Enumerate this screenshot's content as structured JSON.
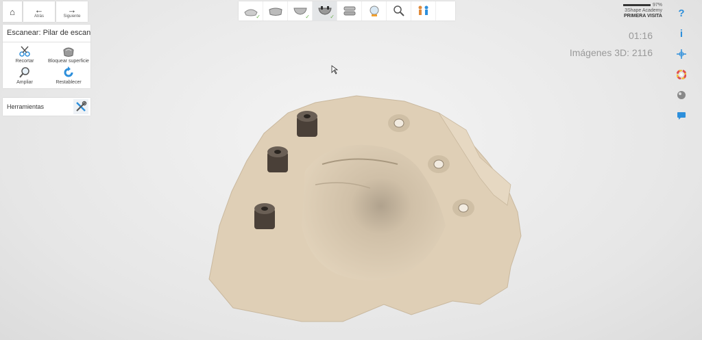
{
  "nav": {
    "back_label": "Atrás",
    "next_label": "Siguiente"
  },
  "panel": {
    "title": "Escanear: Pilar de escanea",
    "tools": [
      {
        "label": "Recortar",
        "icon": "scissors-icon"
      },
      {
        "label": "Bloquear superficie",
        "icon": "lock-surface-icon"
      },
      {
        "label": "Ampliar",
        "icon": "magnifier-icon"
      },
      {
        "label": "Restablecer",
        "icon": "reset-icon"
      }
    ],
    "herramientas_label": "Herramientas"
  },
  "workflow_steps": [
    {
      "icon": "prep-icon",
      "checked": true
    },
    {
      "icon": "lower-jaw-icon",
      "checked": false
    },
    {
      "icon": "upper-jaw-icon",
      "checked": true
    },
    {
      "icon": "scanbody-icon",
      "checked": true,
      "active": true
    },
    {
      "icon": "bite-icon",
      "checked": false
    },
    {
      "icon": "shade-icon",
      "checked": false
    },
    {
      "icon": "analyze-icon",
      "checked": false
    },
    {
      "icon": "send-icon",
      "checked": false
    }
  ],
  "account": {
    "battery": "97%",
    "name": "3Shape Academy",
    "visit": "PRIMERA VISITA"
  },
  "status": {
    "time": "01:16",
    "images": "Imágenes 3D: 2116"
  },
  "right_bar": [
    {
      "name": "help-icon",
      "text": "?"
    },
    {
      "name": "info-icon",
      "text": "i"
    },
    {
      "name": "crosshair-icon",
      "text": ""
    },
    {
      "name": "color-wheel-icon",
      "text": ""
    },
    {
      "name": "sphere-icon",
      "text": ""
    },
    {
      "name": "chat-icon",
      "text": ""
    }
  ],
  "colors": {
    "accent": "#2d8fdb",
    "check": "#6ab04c",
    "model": "#d8c7ad"
  }
}
